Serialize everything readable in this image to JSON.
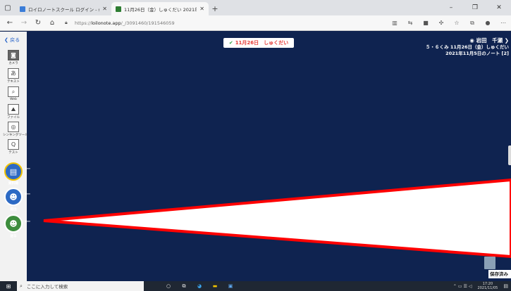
{
  "browser": {
    "tabs": [
      {
        "title": "ロイロノートスクール ログイン - search",
        "active": false
      },
      {
        "title": "11月26日（金）しゅくだい 2021年",
        "active": true
      }
    ],
    "new_tab": "+",
    "url_prefix": "https://",
    "url_host": "loilonote.app",
    "url_path": "/_/3091460/191546059",
    "minimize": "–",
    "restore": "❐",
    "close": "✕"
  },
  "app": {
    "back_label": "戻る",
    "tools": [
      {
        "icon": "camera-icon",
        "label": "カメラ"
      },
      {
        "icon": "text-icon",
        "label": "テキスト"
      },
      {
        "icon": "web-icon",
        "label": "Web"
      },
      {
        "icon": "file-icon",
        "label": "ファイル"
      },
      {
        "icon": "thinking-tool-icon",
        "label": "シンキングツール"
      },
      {
        "icon": "test-icon",
        "label": "テスト"
      }
    ],
    "text_glyph": "あ",
    "test_glyph": "Q",
    "actions": [
      {
        "label": "資料箱"
      },
      {
        "label": "提出"
      },
      {
        "label": "送る"
      }
    ],
    "badge_check": "✔",
    "badge_text": "11月26日　しゅくだい",
    "user_name": "岩田　千瀬",
    "note_title": "５・６くみ 11月26日（金）しゅくだい",
    "note_subtitle": "2021年11月5日のノート [2]",
    "saved_label": "保存済み",
    "colors": {
      "canvas": "#0f2350",
      "arrow_fill": "#ffffff",
      "arrow_stroke": "#ff0000",
      "badge_text": "#e53935"
    }
  },
  "taskbar": {
    "search_placeholder": "ここに入力して検索",
    "time": "17:20",
    "date": "2021/11/05"
  }
}
